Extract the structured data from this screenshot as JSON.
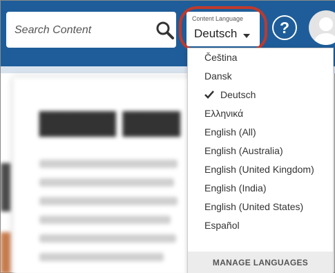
{
  "header": {
    "search": {
      "placeholder": "Search Content",
      "icon": "search-icon"
    },
    "language_selector": {
      "caption": "Content Language",
      "value": "Deutsch",
      "icon": "caret-down-icon"
    },
    "help": {
      "glyph": "?",
      "icon": "help-icon"
    },
    "avatar": {
      "icon": "user-avatar"
    }
  },
  "dropdown": {
    "options": [
      {
        "label": "Čeština",
        "selected": false
      },
      {
        "label": "Dansk",
        "selected": false
      },
      {
        "label": "Deutsch",
        "selected": true
      },
      {
        "label": "Ελληνικά",
        "selected": false
      },
      {
        "label": "English (All)",
        "selected": false
      },
      {
        "label": "English (Australia)",
        "selected": false
      },
      {
        "label": "English (United Kingdom)",
        "selected": false
      },
      {
        "label": "English (India)",
        "selected": false
      },
      {
        "label": "English (United States)",
        "selected": false
      },
      {
        "label": "Español",
        "selected": false
      }
    ],
    "manage_label": "MANAGE LANGUAGES"
  },
  "colors": {
    "header_bg": "#1e5d99",
    "highlight_ring": "#c0392b",
    "manage_bg": "#ececec"
  }
}
